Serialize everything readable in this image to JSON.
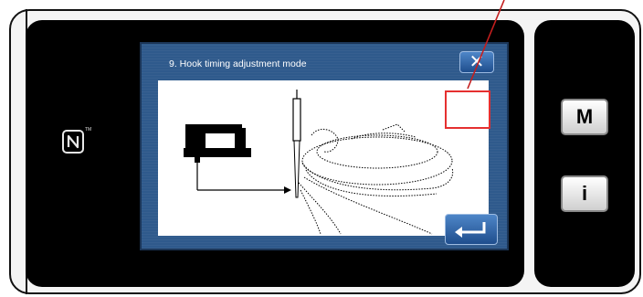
{
  "screen": {
    "title": "9. Hook timing adjustment mode",
    "close_label": "✕",
    "value_display": ""
  },
  "side_buttons": {
    "mode_label": "M",
    "info_label": "i"
  },
  "icons": {
    "nfc": "nfc-logo-icon",
    "close": "close-icon",
    "enter": "enter-arrow-icon"
  },
  "colors": {
    "lcd_background": "#2f5a8c",
    "highlight_frame": "#e53030",
    "button_blue": "#2f66aa"
  }
}
